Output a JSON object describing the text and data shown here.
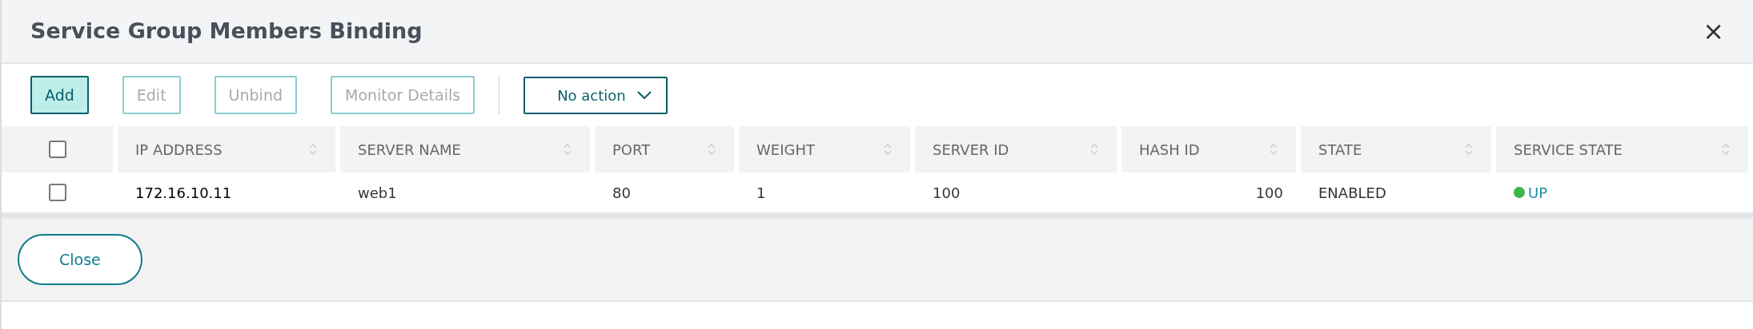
{
  "window": {
    "title": "Service Group Members Binding",
    "close": "×"
  },
  "toolbar": {
    "buttons": [
      {
        "label": "Add",
        "disabled": false
      },
      {
        "label": "Edit",
        "disabled": true
      },
      {
        "label": "Unbind",
        "disabled": true
      },
      {
        "label": "Monitor Details",
        "disabled": true
      }
    ],
    "action_dropdown": {
      "value": "No action"
    }
  },
  "table": {
    "select_all": {
      "checked": false
    },
    "columns": [
      "IP ADDRESS",
      "SERVER NAME",
      "PORT",
      "WEIGHT",
      "SERVER ID",
      "HASH ID",
      "STATE",
      "SERVICE STATE"
    ],
    "rows": [
      {
        "checked": false,
        "cells": [
          "172.16.10.11",
          "web1",
          "80",
          "1",
          "100",
          "100",
          "ENABLED"
        ],
        "service_state": {
          "label": "UP",
          "color": "#3cb64a"
        }
      }
    ]
  },
  "footer": {
    "buttons": [
      "Close"
    ]
  }
}
